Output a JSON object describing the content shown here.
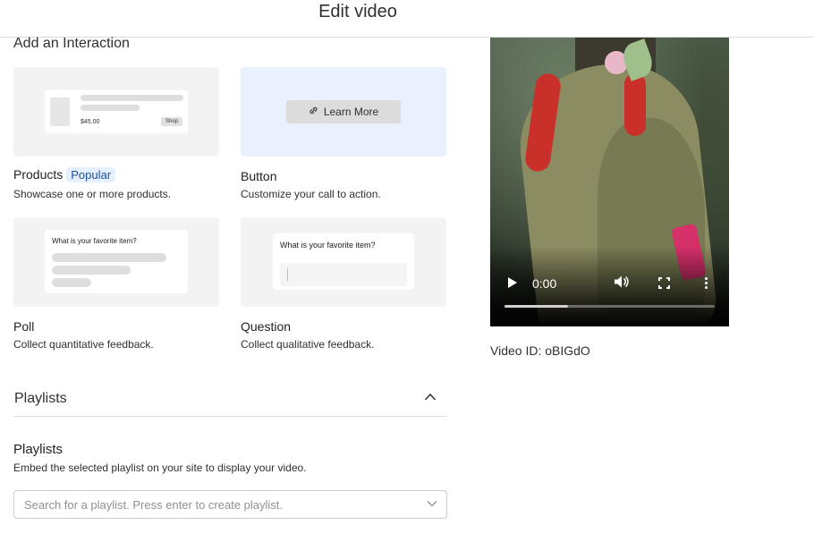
{
  "header": {
    "title": "Edit video"
  },
  "interaction": {
    "heading": "Add an Interaction",
    "cards": [
      {
        "title": "Products",
        "badge": "Popular",
        "desc": "Showcase one or more products.",
        "mock": {
          "price": "$45.00",
          "shop": "Shop"
        }
      },
      {
        "title": "Button",
        "desc": "Customize your call to action.",
        "mock": {
          "button": "Learn More"
        }
      },
      {
        "title": "Poll",
        "desc": "Collect quantitative feedback.",
        "mock": {
          "question": "What is your favorite item?"
        }
      },
      {
        "title": "Question",
        "desc": "Collect qualitative feedback.",
        "mock": {
          "question": "What is your favorite item?"
        }
      }
    ]
  },
  "playlists": {
    "section_label": "Playlists",
    "title": "Playlists",
    "desc": "Embed the selected playlist on your site to display your video.",
    "placeholder": "Search for a playlist. Press enter to create playlist."
  },
  "video": {
    "time": "0:00",
    "progress": 0.3,
    "id_label": "Video ID: oBIGdO"
  },
  "icons": {
    "link": "link-icon",
    "chevron_up": "chevron-up-icon",
    "chevron_down": "chevron-down-icon",
    "play": "play-icon",
    "volume": "volume-icon",
    "fullscreen": "fullscreen-icon",
    "more": "more-vertical-icon"
  },
  "colors": {
    "accent_badge_bg": "#e4efff",
    "accent_badge_text": "#1f5199",
    "button_card_bg": "#e8f1fd"
  }
}
